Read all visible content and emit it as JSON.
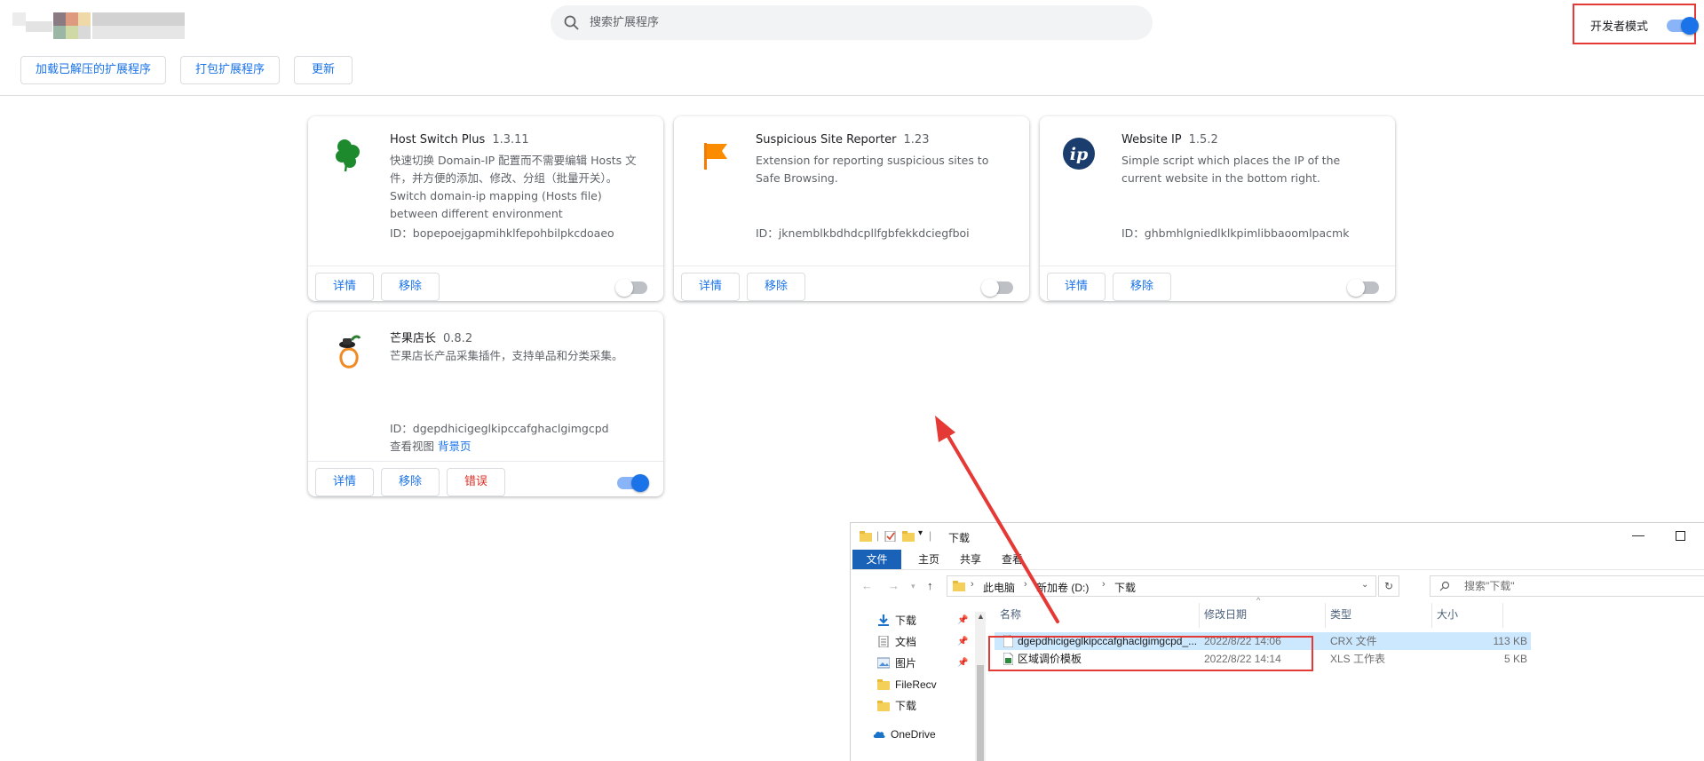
{
  "header": {
    "search_placeholder": "搜索扩展程序",
    "dev_mode_label": "开发者模式",
    "dev_mode_on": true,
    "buttons": {
      "load_unpacked": "加载已解压的扩展程序",
      "pack": "打包扩展程序",
      "update": "更新"
    }
  },
  "extensions": [
    {
      "name": "Host Switch Plus",
      "version": "1.3.11",
      "description": "快速切换 Domain-IP 配置而不需要编辑 Hosts 文件，并方便的添加、修改、分组（批量开关）。Switch domain-ip mapping (Hosts file) between different environment",
      "id": "ID：bopepoejgapmihklfepohbilpkcdoaeo",
      "details": "详情",
      "remove": "移除",
      "enabled": false,
      "icon": "clover-icon"
    },
    {
      "name": "Suspicious Site Reporter",
      "version": "1.23",
      "description": "Extension for reporting suspicious sites to Safe Browsing.",
      "id": "ID：jknemblkbdhdcpllfgbfekkdciegfboi",
      "details": "详情",
      "remove": "移除",
      "enabled": false,
      "icon": "flag-icon"
    },
    {
      "name": "Website IP",
      "version": "1.5.2",
      "description": "Simple script which places the IP of the current website in the bottom right.",
      "id": "ID：ghbmhlgniedlklkpimlibbaoomlpacmk",
      "details": "详情",
      "remove": "移除",
      "enabled": false,
      "icon": "ip-icon"
    },
    {
      "name": "芒果店长",
      "version": "0.8.2",
      "description": "芒果店长产品采集插件，支持单品和分类采集。",
      "id": "ID：dgepdhicigeglkipccafghaclgimgcpd",
      "views_label": "查看视图",
      "views_link": "背景页",
      "details": "详情",
      "remove": "移除",
      "errors": "错误",
      "enabled": true,
      "icon": "mango-icon"
    }
  ],
  "explorer": {
    "title": "下载",
    "minimize": "—",
    "ribbon_tabs": [
      "文件",
      "主页",
      "共享",
      "查看"
    ],
    "address": [
      "此电脑",
      "新加卷 (D:)",
      "下载"
    ],
    "search_placeholder": "搜索\"下载\"",
    "nav_items": [
      {
        "label": "下载",
        "icon": "download-arrow-icon",
        "pinned": true
      },
      {
        "label": "文档",
        "icon": "document-icon",
        "pinned": true
      },
      {
        "label": "图片",
        "icon": "picture-icon",
        "pinned": true
      },
      {
        "label": "FileRecv",
        "icon": "folder-icon",
        "pinned": false
      },
      {
        "label": "下载",
        "icon": "folder-icon",
        "pinned": false
      },
      {
        "label": "OneDrive",
        "icon": "cloud-icon",
        "pinned": false
      }
    ],
    "columns": [
      "名称",
      "修改日期",
      "类型",
      "大小"
    ],
    "files": [
      {
        "name": "dgepdhicigeglkipccafghaclgimgcpd_...",
        "date": "2022/8/22 14:06",
        "type": "CRX 文件",
        "size": "113 KB",
        "selected": true,
        "icon": "file-icon"
      },
      {
        "name": "区域调价模板",
        "date": "2022/8/22 14:14",
        "type": "XLS 工作表",
        "size": "5 KB",
        "selected": false,
        "icon": "spreadsheet-icon"
      }
    ]
  },
  "colors": {
    "accent": "#1a73e8",
    "annotation_red": "#e53935",
    "error": "#d93025",
    "selection": "#cce8ff"
  }
}
